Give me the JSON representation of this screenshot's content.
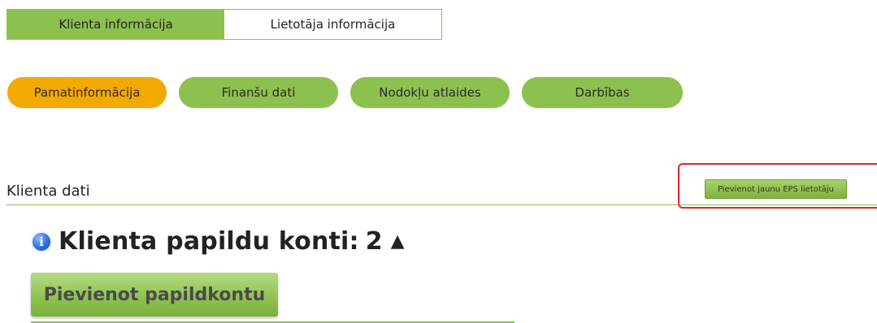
{
  "top_tabs": [
    {
      "label": "Klienta informācija",
      "active": true
    },
    {
      "label": "Lietotāja informācija",
      "active": false
    }
  ],
  "pill_tabs": [
    {
      "label": "Pamatinformācija",
      "active": true
    },
    {
      "label": "Finanšu dati",
      "active": false
    },
    {
      "label": "Nodokļu atlaides",
      "active": false
    },
    {
      "label": "Darbības",
      "active": false
    }
  ],
  "section": {
    "title": "Klienta dati",
    "add_user_button": "Pievienot jaunu EPS lietotāju"
  },
  "accounts": {
    "title": "Klienta papildu konti:",
    "count": "2",
    "add_button": "Pievienot papildkontu"
  },
  "colors": {
    "green": "#8dc14f",
    "orange": "#f2a900",
    "highlight_red": "#e0262a"
  },
  "icons": {
    "info": "info-icon",
    "sort": "triangle-up-icon"
  }
}
